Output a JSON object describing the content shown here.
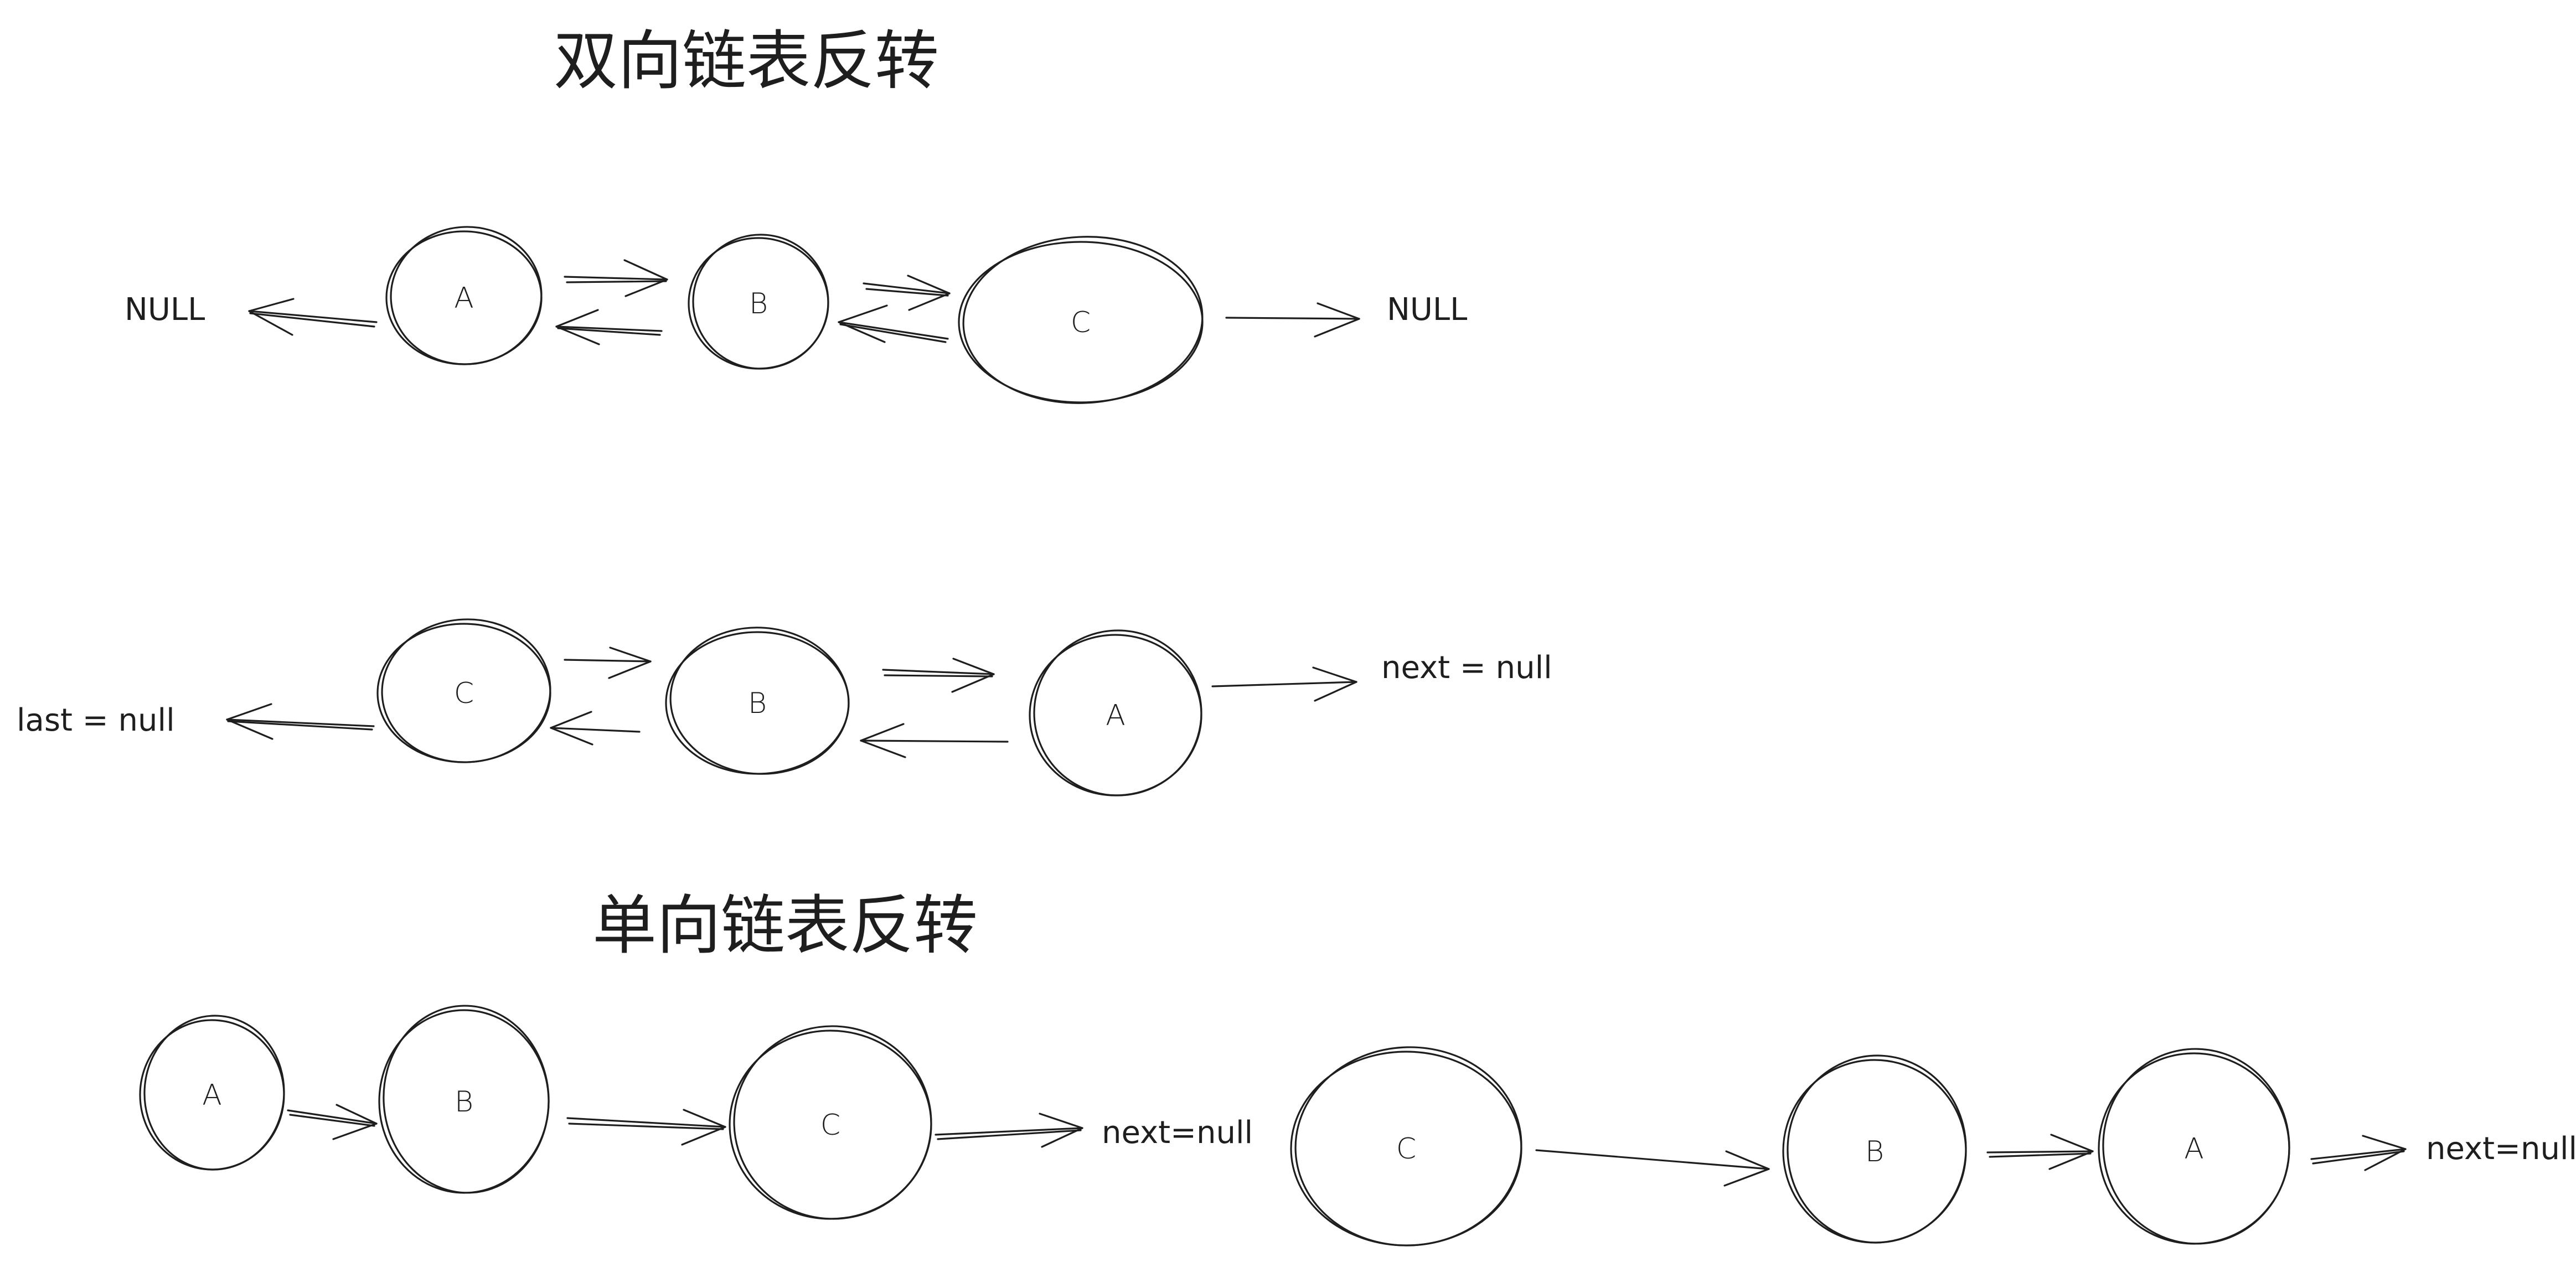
{
  "titles": {
    "doubly": "双向链表反转",
    "singly": "单向链表反转"
  },
  "row1": {
    "left_end": "NULL",
    "nodes": [
      "A",
      "B",
      "C"
    ],
    "right_end": "NULL"
  },
  "row2": {
    "left_end": "last = null",
    "nodes": [
      "C",
      "B",
      "A"
    ],
    "right_end": "next = null"
  },
  "row3": {
    "nodes": [
      "A",
      "B",
      "C"
    ],
    "right_end": "next=null"
  },
  "row4": {
    "nodes": [
      "C",
      "B",
      "A"
    ],
    "right_end": "next=null"
  },
  "colors": {
    "ink": "#1e1e1e",
    "background": "#ffffff"
  }
}
